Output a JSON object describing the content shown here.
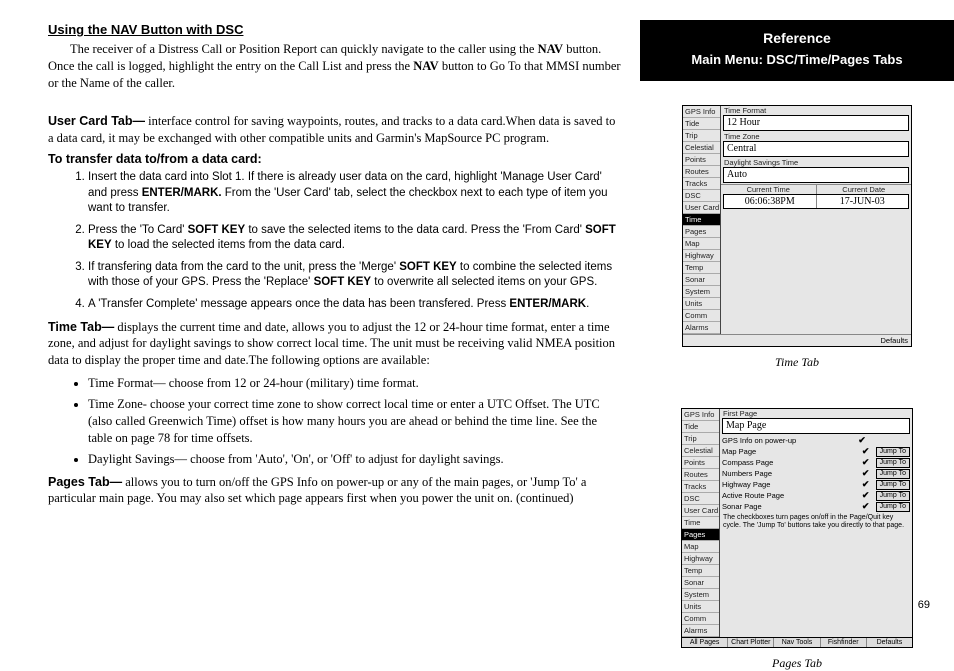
{
  "left": {
    "heading1": "Using the NAV Button with DSC",
    "p1a": "The receiver of a Distress Call or Position Report can quickly navigate to the caller using the ",
    "p1b": "NAV",
    "p1c": " button. Once the call is logged, highlight the entry on the Call List and press the ",
    "p1d": "NAV",
    "p1e": " button to Go To that MMSI number or the Name of the caller.",
    "userCardLead": "User Card Tab—",
    "userCardText": " interface control for saving waypoints, routes, and tracks to a data card.When data is saved to a data card, it may be exchanged with other compatible units and Garmin's MapSource PC program.",
    "transferHead": "To transfer data to/from a data card:",
    "steps": [
      {
        "a": "Insert the data card into Slot 1. If there is already user data on the card, highlight 'Manage User Card' and press ",
        "b": " ENTER/MARK.",
        "c": "  From the 'User Card' tab, select the checkbox next to each type of item you want to transfer."
      },
      {
        "a": "Press the 'To Card' ",
        "b": "SOFT KEY",
        "c": " to save the selected items to the data card. Press the 'From Card' ",
        "d": "SOFT KEY",
        "e": " to load the selected items from the data card."
      },
      {
        "a": "If transfering data from the card to the unit, press the 'Merge' ",
        "b": "SOFT KEY",
        "c": " to combine the selected items with those of your GPS. Press the 'Replace' ",
        "d": "SOFT KEY",
        "e": " to overwrite all selected items on your GPS."
      },
      {
        "a": "A 'Transfer Complete' message appears once the data has been transfered. Press ",
        "b": "ENTER/MARK",
        "c": "."
      }
    ],
    "timeLead": "Time Tab—",
    "timeText": " displays the current time and date, allows you to adjust the 12 or 24-hour time format, enter a time zone, and adjust for daylight savings to show correct local time. The unit must be receiving valid NMEA position data to display the proper time and date.The following options are available:",
    "bullets": [
      "Time Format— choose from 12 or 24-hour (military) time format.",
      "Time Zone- choose your correct time zone to show correct local time or enter a UTC Offset. The UTC (also called Greenwich Time) offset is how many hours you are ahead or behind the time line. See the table on page 78 for time offsets.",
      "Daylight Savings— choose from 'Auto', 'On', or 'Off' to adjust for daylight savings."
    ],
    "pagesLead": "Pages Tab—",
    "pagesText": " allows you to turn on/off the GPS Info on power-up or any of the main pages, or 'Jump To' a particular main page. You may also set which page appears first when you power the unit on. (continued)"
  },
  "right": {
    "refTitle": "Reference",
    "refSub": "Main Menu: DSC/Time/Pages Tabs",
    "timeTab": {
      "caption": "Time Tab",
      "sidebar": [
        "GPS Info",
        "Tide",
        "Trip",
        "Celestial",
        "Points",
        "Routes",
        "Tracks",
        "DSC",
        "User Card",
        "Time",
        "Pages",
        "Map",
        "Highway",
        "Temp",
        "Sonar",
        "System",
        "Units",
        "Comm",
        "Alarms"
      ],
      "selected": "Time",
      "fields": {
        "f1l": "Time Format",
        "f1v": "12 Hour",
        "f2l": "Time Zone",
        "f2v": "Central",
        "f3l": "Daylight Savings Time",
        "f3v": "Auto",
        "ctl": "Current Time",
        "cdl": "Current Date",
        "ctv": "06:06:38PM",
        "cdv": "17-JUN-03"
      },
      "defaults": "Defaults"
    },
    "pagesTab": {
      "caption": "Pages Tab",
      "sidebar": [
        "GPS Info",
        "Tide",
        "Trip",
        "Celestial",
        "Points",
        "Routes",
        "Tracks",
        "DSC",
        "User Card",
        "Time",
        "Pages",
        "Map",
        "Highway",
        "Temp",
        "Sonar",
        "System",
        "Units",
        "Comm",
        "Alarms"
      ],
      "selected": "Pages",
      "firstPageLabel": "First Page",
      "firstPageValue": "Map Page",
      "rows": [
        {
          "label": "GPS Info on power-up",
          "check": true,
          "jump": false
        },
        {
          "label": "Map Page",
          "check": true,
          "jump": true
        },
        {
          "label": "Compass Page",
          "check": true,
          "jump": true
        },
        {
          "label": "Numbers Page",
          "check": true,
          "jump": true
        },
        {
          "label": "Highway Page",
          "check": true,
          "jump": true
        },
        {
          "label": "Active Route Page",
          "check": true,
          "jump": true
        },
        {
          "label": "Sonar Page",
          "check": true,
          "jump": true
        }
      ],
      "jumpLabel": "Jump To",
      "note": "The checkboxes turn pages on/off in the Page/Quit key cycle. The 'Jump To' buttons take you directly to that page.",
      "bottomTabs": [
        "All Pages",
        "Chart Plotter",
        "Nav Tools",
        "Fishfinder",
        "Defaults"
      ]
    }
  },
  "pageNumber": "69"
}
